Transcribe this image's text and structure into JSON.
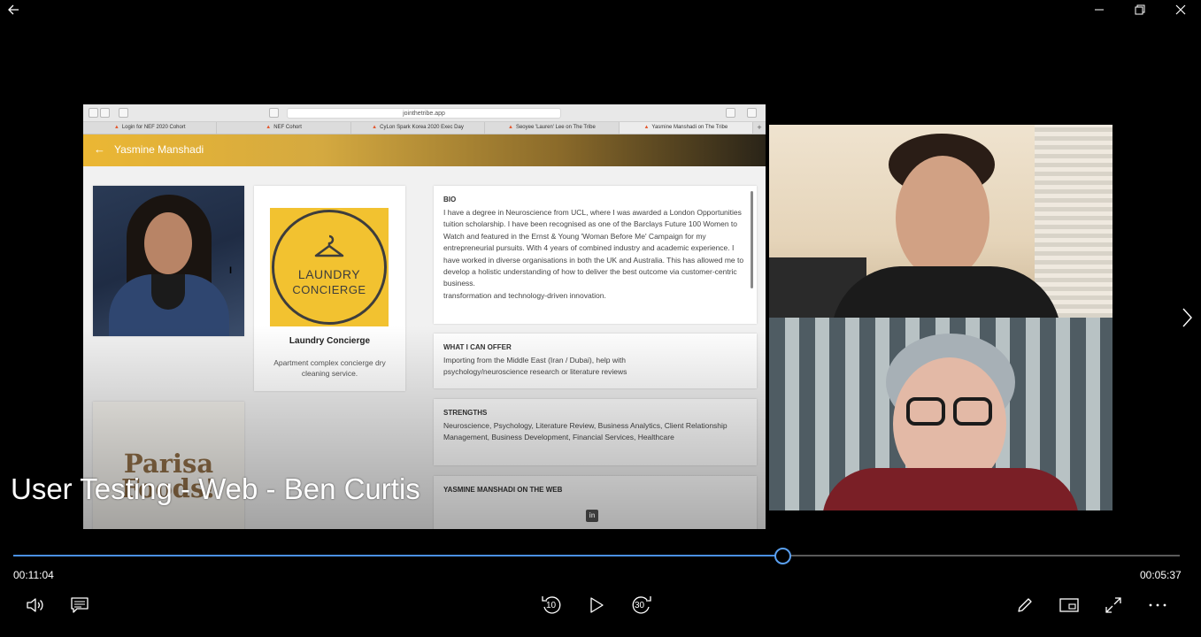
{
  "window": {
    "back_icon": "back-arrow-icon",
    "minimize_icon": "minimize-icon",
    "restore_icon": "restore-icon",
    "close_icon": "close-icon"
  },
  "recording": {
    "url": "jointhetribe.app",
    "tabs": [
      "Login for NEF 2020 Cohort",
      "NEF Cohort",
      "CyLon Spark Korea 2020 Exec Day",
      "Seoyee 'Lauren' Lee on The Tribe",
      "Yasmine Manshadi on The Tribe"
    ],
    "header": {
      "back": "←",
      "name": "Yasmine Manshadi"
    },
    "company": {
      "logo_line1": "LAUNDRY",
      "logo_line2": "CONCIERGE",
      "name": "Laundry Concierge",
      "description": "Apartment complex concierge dry cleaning service."
    },
    "bio": {
      "heading": "BIO",
      "text": "I have a degree in Neuroscience from UCL, where I was awarded a London Opportunities tuition scholarship. I have been recognised as one of the Barclays Future 100 Women to Watch and featured in the Ernst & Young 'Woman Before Me' Campaign for my entrepreneurial pursuits. With 4 years of combined industry and academic experience. I have worked in diverse organisations in both the UK and Australia. This has allowed me to develop a holistic understanding of how to deliver the best outcome via customer-centric business.",
      "text2": "transformation and technology-driven innovation."
    },
    "offer": {
      "heading": "WHAT I CAN OFFER",
      "text": "Importing from the Middle East (Iran / Dubai), help with psychology/neuroscience research or literature reviews"
    },
    "strengths": {
      "heading": "STRENGTHS",
      "text": "Neuroscience, Psychology, Literature Review, Business Analytics, Client Relationship Management, Business Development, Financial Services, Healthcare"
    },
    "web": {
      "heading": "YASMINE MANSHADI ON THE WEB",
      "linkedin": "in"
    },
    "second_company": {
      "logo_line1": "Parisa",
      "logo_line2": "Foods!"
    }
  },
  "player": {
    "title": "User Testing - Web - Ben Curtis",
    "elapsed": "00:11:04",
    "remaining": "00:05:37",
    "progress": 0.66,
    "skip_back_seconds": "10",
    "skip_forward_seconds": "30",
    "accent_color": "#4a90e2"
  }
}
